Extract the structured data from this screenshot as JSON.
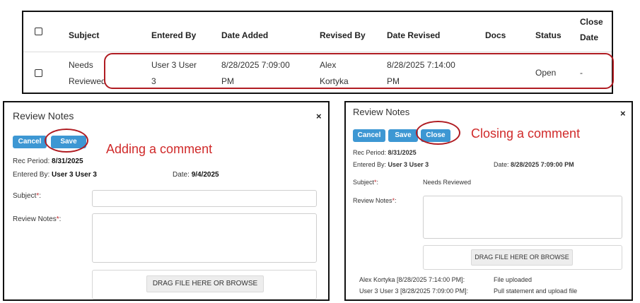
{
  "table": {
    "columns": [
      "Subject",
      "Entered By",
      "Date Added",
      "Revised By",
      "Date Revised",
      "Docs",
      "Status",
      "Close Date"
    ],
    "row": {
      "subject": [
        "Needs",
        "Reviewed"
      ],
      "entered_by": [
        "User 3 User",
        "3"
      ],
      "date_added": [
        "8/28/2025 7:09:00",
        "PM"
      ],
      "revised_by": [
        "Alex",
        "Kortyka"
      ],
      "date_revised": [
        "8/28/2025 7:14:00",
        "PM"
      ],
      "docs": "",
      "status": "Open",
      "close_date": "-"
    },
    "close_date_header": [
      "Close",
      "Date"
    ]
  },
  "left_modal": {
    "title": "Review Notes",
    "close_symbol": "×",
    "buttons": {
      "cancel": "Cancel",
      "save": "Save"
    },
    "annotation": "Adding a comment",
    "rec_period_label": "Rec Period:",
    "rec_period_value": "8/31/2025",
    "entered_by_label": "Entered By:",
    "entered_by_value": "User 3 User 3",
    "date_label": "Date:",
    "date_value": "9/4/2025",
    "subject_label": "Subject",
    "notes_label": "Review Notes",
    "required_mark": "*",
    "colon": ":",
    "subject_value": "",
    "notes_value": "",
    "dropzone_label": "DRAG FILE HERE OR BROWSE"
  },
  "right_modal": {
    "title": "Review Notes",
    "close_symbol": "×",
    "buttons": {
      "cancel": "Cancel",
      "save": "Save",
      "close": "Close"
    },
    "annotation": "Closing a comment",
    "rec_period_label": "Rec Period:",
    "rec_period_value": "8/31/2025",
    "entered_by_label": "Entered By:",
    "entered_by_value": "User 3 User 3",
    "date_label": "Date:",
    "date_value": "8/28/2025 7:09:00 PM",
    "subject_label": "Subject",
    "subject_value": "Needs Reviewed",
    "notes_label": "Review Notes",
    "required_mark": "*",
    "colon": ":",
    "notes_value": "",
    "dropzone_label": "DRAG FILE HERE OR BROWSE",
    "history": [
      {
        "author": "Alex Kortyka [8/28/2025 7:14:00 PM]:",
        "text": "File uploaded"
      },
      {
        "author": "User 3 User 3 [8/28/2025 7:09:00 PM]:",
        "text": "Pull statement and upload file"
      }
    ]
  },
  "colors": {
    "accent": "#3d97d3",
    "highlight": "#b01c22",
    "annotation": "#d02a2a"
  }
}
